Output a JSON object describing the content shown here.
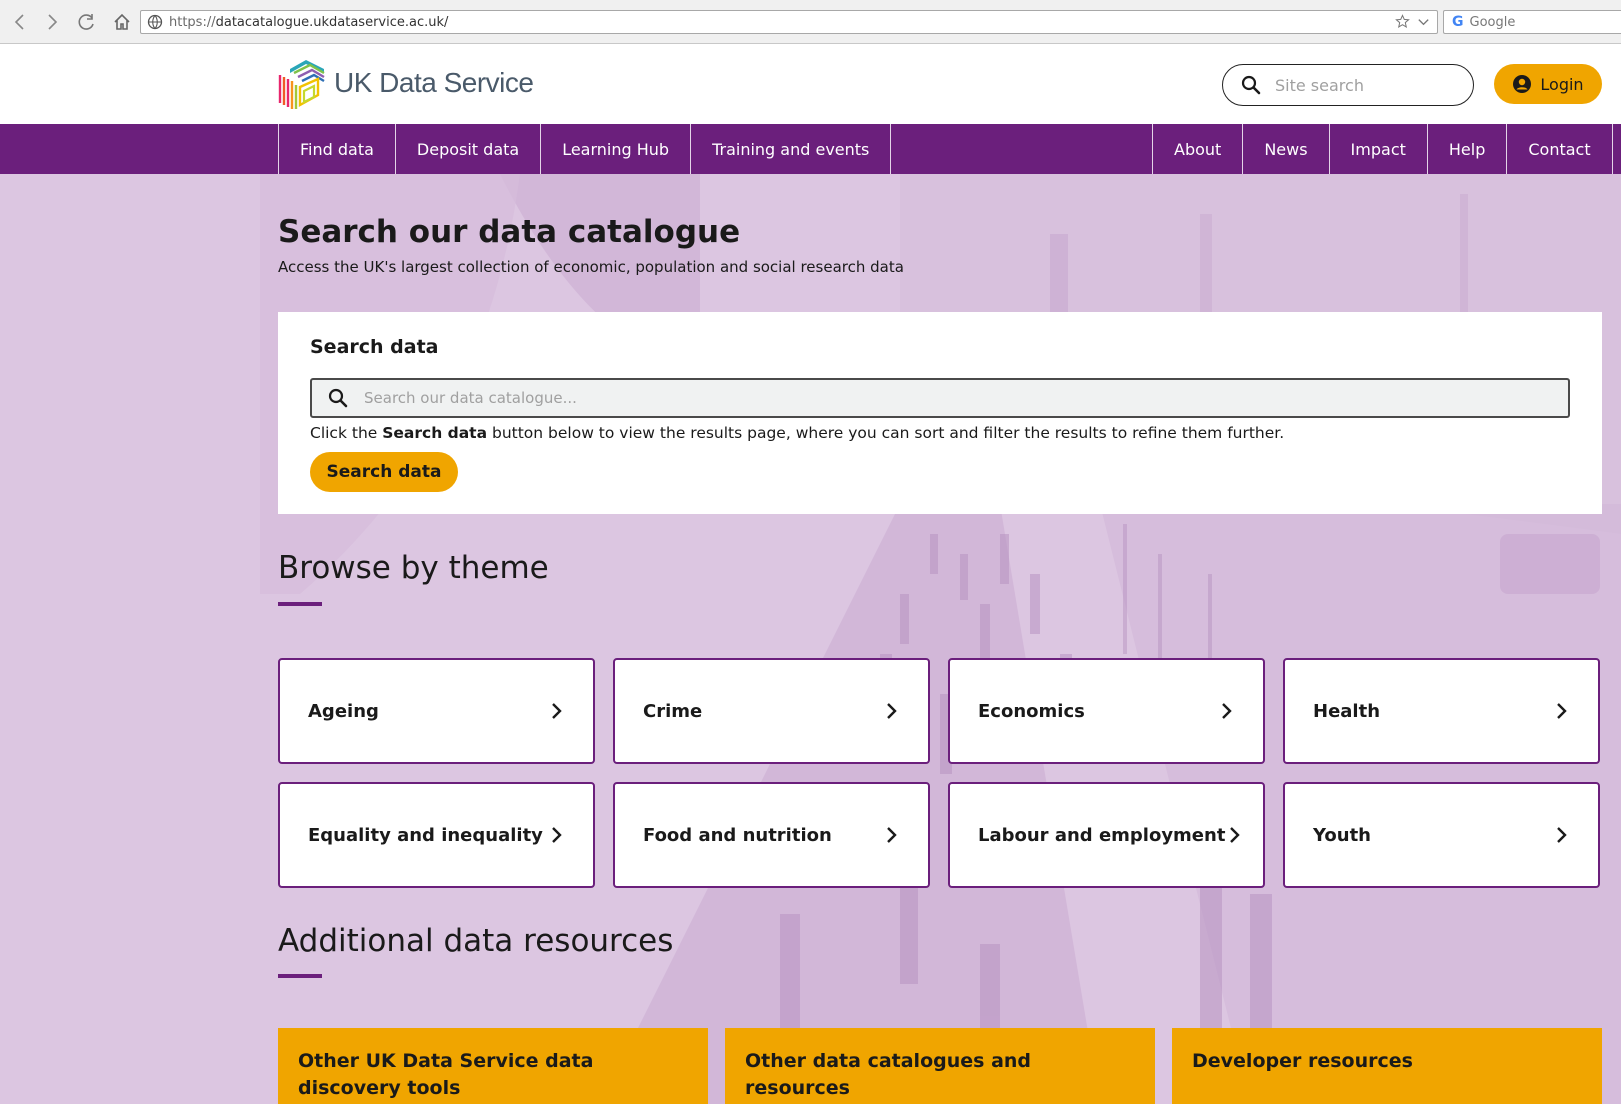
{
  "browser": {
    "url_prefix": "https://",
    "url_host": "datacatalogue.ukdataservice.ac.uk/",
    "search_engine_placeholder": "Google"
  },
  "header": {
    "logo_text": "UK Data Service",
    "site_search_placeholder": "Site search",
    "login_label": "Login"
  },
  "nav": {
    "left": [
      "Find data",
      "Deposit data",
      "Learning Hub",
      "Training and events"
    ],
    "right": [
      "About",
      "News",
      "Impact",
      "Help",
      "Contact"
    ]
  },
  "hero": {
    "title": "Search our data catalogue",
    "subtitle": "Access the UK's largest collection of economic, population and social research data"
  },
  "search": {
    "card_title": "Search data",
    "input_placeholder": "Search our data catalogue...",
    "help_before": "Click the ",
    "help_bold": "Search data",
    "help_after": " button below to view the results page, where you can sort and filter the results to refine them further.",
    "button_label": "Search data"
  },
  "themes": {
    "title": "Browse by theme",
    "items": [
      "Ageing",
      "Crime",
      "Economics",
      "Health",
      "Equality and inequality",
      "Food and nutrition",
      "Labour and employment",
      "Youth"
    ]
  },
  "resources": {
    "title": "Additional data resources",
    "items": [
      "Other UK Data Service data discovery tools",
      "Other data catalogues and resources",
      "Developer resources"
    ]
  },
  "colors": {
    "brand_purple": "#6b1f7c",
    "accent_amber": "#f0a500",
    "hero_tint": "#dcc6e1"
  }
}
